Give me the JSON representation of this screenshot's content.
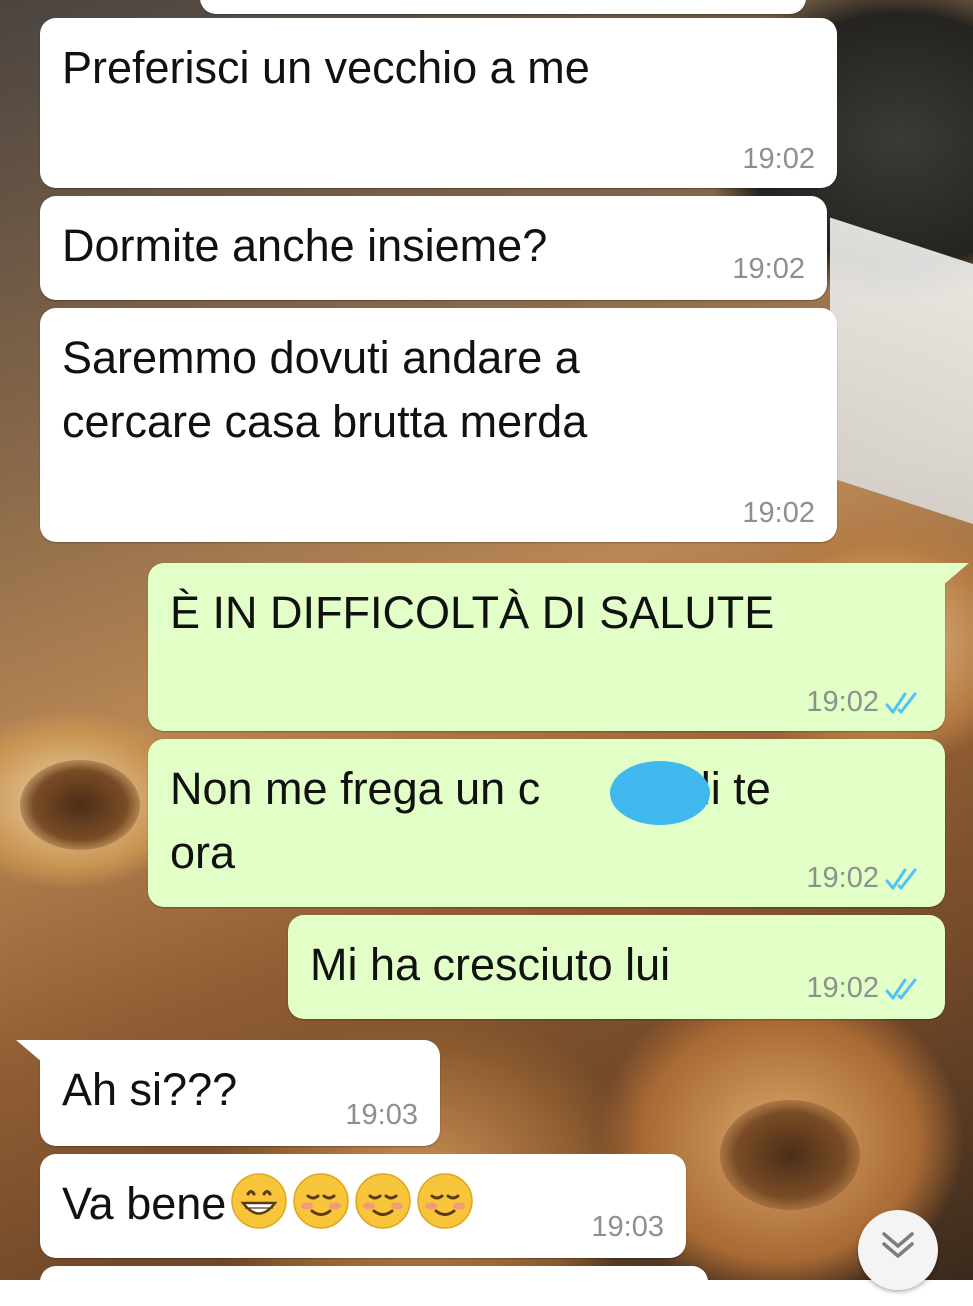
{
  "conversation": {
    "messages": [
      {
        "direction": "in",
        "text": "Preferisci un vecchio a me",
        "time": "19:02"
      },
      {
        "direction": "in",
        "text": "Dormite anche insieme?",
        "time": "19:02"
      },
      {
        "direction": "in",
        "text": "Saremmo dovuti andare a\ncercare casa brutta merda",
        "time": "19:02"
      },
      {
        "direction": "out",
        "text": "È IN DIFFICOLTÀ DI SALUTE",
        "time": "19:02",
        "status": "read"
      },
      {
        "direction": "out",
        "text_before": "Non me frega un c",
        "text_after": "o di te",
        "text_line2": "ora",
        "time": "19:02",
        "status": "read",
        "redacted": true
      },
      {
        "direction": "out",
        "text": "Mi ha cresciuto lui",
        "time": "19:02",
        "status": "read"
      },
      {
        "direction": "in",
        "text": "Ah si???",
        "time": "19:03"
      },
      {
        "direction": "in",
        "text": "Va bene",
        "time": "19:03",
        "emojis": [
          "grinning-face",
          "smiling-face",
          "smiling-face",
          "smiling-face"
        ]
      }
    ]
  },
  "colors": {
    "incoming_bubble": "#ffffff",
    "outgoing_bubble": "#e1ffc7",
    "read_ticks": "#4fc3f7",
    "timestamp": "#8c918d",
    "redaction": "#3fb8ee"
  },
  "icons": {
    "read_receipt": "double-check-icon",
    "scroll_down": "double-chevron-down-icon"
  }
}
